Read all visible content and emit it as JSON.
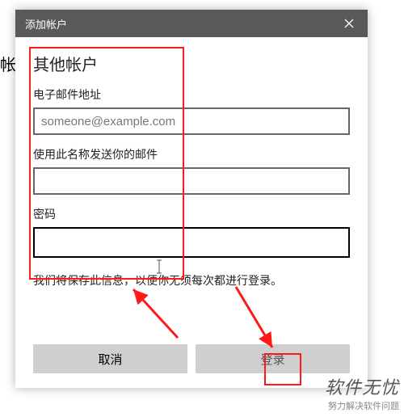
{
  "background": {
    "partial_label": "帐,"
  },
  "dialog": {
    "title": "添加帐户",
    "close_icon": "close",
    "section_title": "其他帐户",
    "email": {
      "label": "电子邮件地址",
      "placeholder": "someone@example.com",
      "value": ""
    },
    "display_name": {
      "label": "使用此名称发送你的邮件",
      "value": ""
    },
    "password": {
      "label": "密码",
      "value": ""
    },
    "note": "我们将保存此信息，以便你无须每次都进行登录。",
    "buttons": {
      "cancel": "取消",
      "signin": "登录"
    }
  },
  "watermark": {
    "line1": "软件无忧",
    "line2": "努力解决软件问题"
  }
}
